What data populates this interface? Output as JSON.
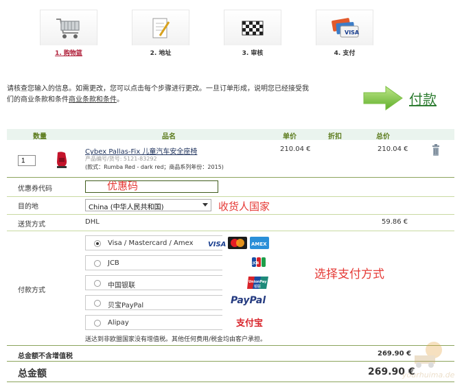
{
  "steps": [
    {
      "label": "1. 购物篮",
      "icon": "cart-icon",
      "active": true
    },
    {
      "label": "2. 地址",
      "icon": "notepad-icon",
      "active": false
    },
    {
      "label": "3. 审核",
      "icon": "checkered-flag-icon",
      "active": false
    },
    {
      "label": "4. 支付",
      "icon": "credit-cards-icon",
      "active": false
    }
  ],
  "intro": {
    "text": "请核查您输入的信息。如需更改，您可以点击每个步骤进行更改。一旦订单形成，说明您已经接受我们的商业条款和条件",
    "link": "商业条款和条件",
    "end": "。"
  },
  "pay_button": {
    "label": "付款",
    "icon": "green-arrow-icon"
  },
  "table_header": {
    "qty": "数量",
    "name": "品名",
    "unit_price": "单价",
    "discount": "折扣",
    "total": "总价"
  },
  "item": {
    "qty": "1",
    "name": "Cybex Pallas-Fix 儿童汽车安全座椅",
    "code": "产品编号/货号: 5121-83292",
    "attrs": "(款式：Rumba Red - dark red；商品系列年份：2015)",
    "unit_price": "210.04 €",
    "total": "210.04 €"
  },
  "coupon": {
    "label": "优惠券代码",
    "value": "",
    "annotation": "优惠码"
  },
  "destination": {
    "label": "目的地",
    "value": "China (中华人民共和国)",
    "annotation": "收货人国家"
  },
  "shipping": {
    "label": "送货方式",
    "value": "DHL",
    "price": "59.86 €"
  },
  "payment": {
    "label": "付款方式",
    "annotation": "选择支付方式",
    "options": [
      {
        "label": "Visa / Mastercard / Amex",
        "selected": true
      },
      {
        "label": "JCB",
        "selected": false
      },
      {
        "label": "中国银联",
        "selected": false
      },
      {
        "label": "贝宝PayPal",
        "selected": false
      },
      {
        "label": "Alipay",
        "selected": false
      }
    ],
    "logos": {
      "visa": "VISA",
      "amex": "AMEX",
      "unionpay": "UnionPay",
      "unionpay_cn": "银联",
      "paypal": "PayPal",
      "alipay": "支付宝",
      "jcb": "JCB"
    },
    "note": "送达到非欧盟国家没有增值税。其他任何费用/税金均由客户承担。"
  },
  "totals": {
    "net_label": "总金额不含增值税",
    "net_value": "269.90 €",
    "gross_label": "总金额",
    "gross_value": "269.90 €"
  },
  "watermark": "yourhuima.de",
  "colors": {
    "accent_green": "#2e7d32",
    "annotation_red": "#e53935",
    "active_step": "#b0203a"
  }
}
